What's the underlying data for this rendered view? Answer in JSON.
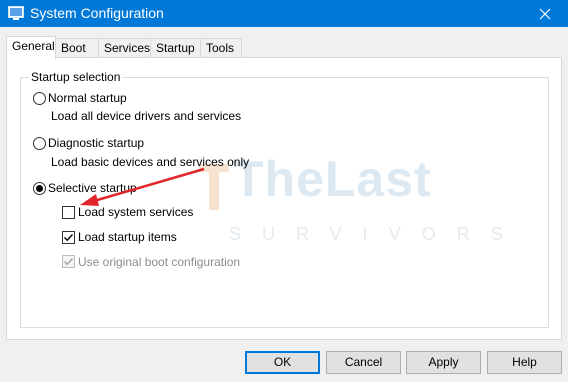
{
  "window": {
    "title": "System Configuration",
    "app_icon": "msconfig-icon",
    "close_icon": "close-icon",
    "titlebar_color": "#0078d7"
  },
  "tabs": [
    {
      "label": "General",
      "active": true
    },
    {
      "label": "Boot",
      "active": false
    },
    {
      "label": "Services",
      "active": false
    },
    {
      "label": "Startup",
      "active": false
    },
    {
      "label": "Tools",
      "active": false
    }
  ],
  "startup_selection": {
    "legend": "Startup selection",
    "normal": {
      "label": "Normal startup",
      "description": "Load all device drivers and services",
      "selected": false
    },
    "diagnostic": {
      "label": "Diagnostic startup",
      "description": "Load basic devices and services only",
      "selected": false
    },
    "selective": {
      "label": "Selective startup",
      "selected": true,
      "options": {
        "system_services": {
          "label": "Load system services",
          "checked": false,
          "enabled": true
        },
        "startup_items": {
          "label": "Load startup items",
          "checked": true,
          "enabled": true
        },
        "boot_config": {
          "label": "Use original boot configuration",
          "checked": true,
          "enabled": false
        }
      }
    }
  },
  "buttons": {
    "ok": "OK",
    "cancel": "Cancel",
    "apply": "Apply",
    "help": "Help"
  },
  "watermark": {
    "main": "TheLast",
    "sub": "SURVIVORS"
  },
  "annotation": {
    "arrow_color": "#e3262a"
  }
}
